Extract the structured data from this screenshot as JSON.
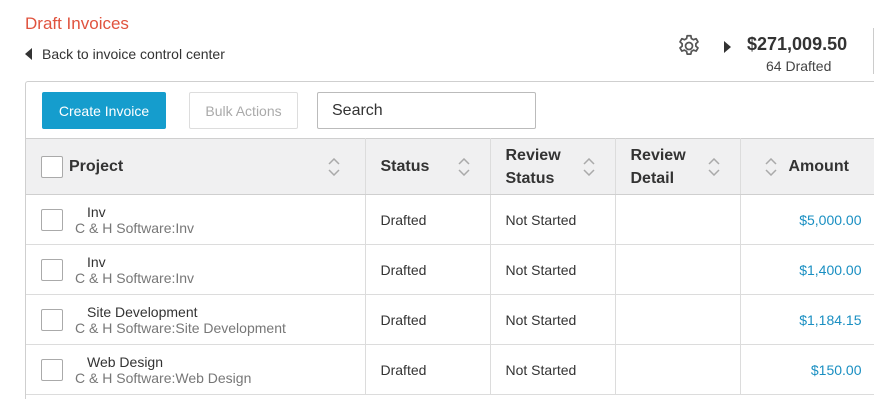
{
  "header": {
    "title": "Draft Invoices",
    "back_label": "Back to invoice control center",
    "total_amount": "$271,009.50",
    "drafted_count": "64 Drafted"
  },
  "toolbar": {
    "create_label": "Create Invoice",
    "bulk_label": "Bulk Actions",
    "search_placeholder": "Search"
  },
  "table": {
    "columns": [
      "Project",
      "Status",
      "Review Status",
      "Review Detail",
      "Amount"
    ],
    "rows": [
      {
        "project": "Inv",
        "client": "C & H Software:Inv",
        "status": "Drafted",
        "review_status": "Not Started",
        "review_detail": "",
        "amount": "$5,000.00"
      },
      {
        "project": "Inv",
        "client": "C & H Software:Inv",
        "status": "Drafted",
        "review_status": "Not Started",
        "review_detail": "",
        "amount": "$1,400.00"
      },
      {
        "project": "Site Development",
        "client": "C & H Software:Site Development",
        "status": "Drafted",
        "review_status": "Not Started",
        "review_detail": "",
        "amount": "$1,184.15"
      },
      {
        "project": "Web Design",
        "client": "C & H Software:Web Design",
        "status": "Drafted",
        "review_status": "Not Started",
        "review_detail": "",
        "amount": "$150.00"
      }
    ]
  },
  "colors": {
    "title": "#e0533e",
    "primary_button": "#159dcd",
    "amount_link": "#1a8fc2"
  },
  "icons": {
    "settings": "gear-icon",
    "back": "triangle-left-icon",
    "expand": "triangle-right-icon",
    "sort": "sort-icon"
  }
}
